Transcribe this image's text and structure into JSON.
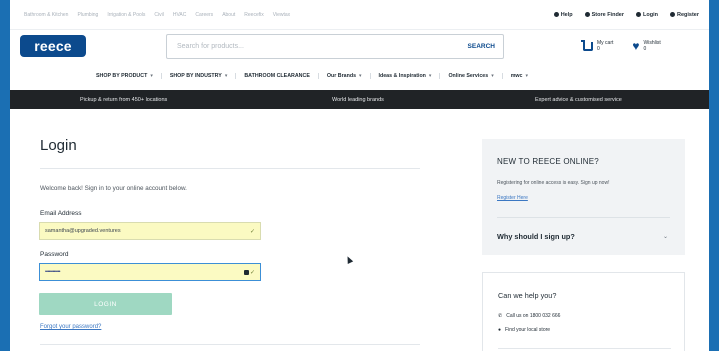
{
  "util_links": [
    "Bathroom & Kitchen",
    "Plumbing",
    "Irrigation & Pools",
    "Civil",
    "HVAC",
    "Careers",
    "About",
    "Reecefix",
    "Viewtax"
  ],
  "util_right": {
    "help": "Help",
    "store_finder": "Store Finder",
    "login": "Login",
    "register": "Register"
  },
  "logo": "reece",
  "search": {
    "placeholder": "Search for products...",
    "button": "SEARCH"
  },
  "cart": {
    "label": "My cart",
    "count": "0"
  },
  "wishlist": {
    "label": "Wishlist",
    "count": "0"
  },
  "nav": [
    {
      "label": "SHOP BY PRODUCT",
      "chev": "▾"
    },
    {
      "label": "SHOP BY INDUSTRY",
      "chev": "▾"
    },
    {
      "label": "BATHROOM CLEARANCE",
      "chev": ""
    },
    {
      "label": "Our Brands",
      "chev": "▾"
    },
    {
      "label": "Ideas & Inspiration",
      "chev": "▾"
    },
    {
      "label": "Online Services",
      "chev": "▾"
    },
    {
      "label": "mwc",
      "chev": "▾"
    }
  ],
  "strip": [
    "Pickup & return from 450+ locations",
    "World leading brands",
    "Expert advice & customised service"
  ],
  "login": {
    "title": "Login",
    "welcome": "Welcome back! Sign in to your online account below.",
    "email_label": "Email Address",
    "email_value": "samantha@upgraded.ventures",
    "password_label": "Password",
    "password_value": "••••••••••••",
    "button": "LOGIN",
    "forgot": "Forgot your password?"
  },
  "new_panel": {
    "title": "NEW TO REECE ONLINE?",
    "desc": "Registering for online access is easy. Sign up now!",
    "register": "Register Here",
    "why": "Why should I sign up?"
  },
  "help_panel": {
    "title": "Can we help you?",
    "call": "Call us on 1800 032 666",
    "store": "Find your local store"
  }
}
